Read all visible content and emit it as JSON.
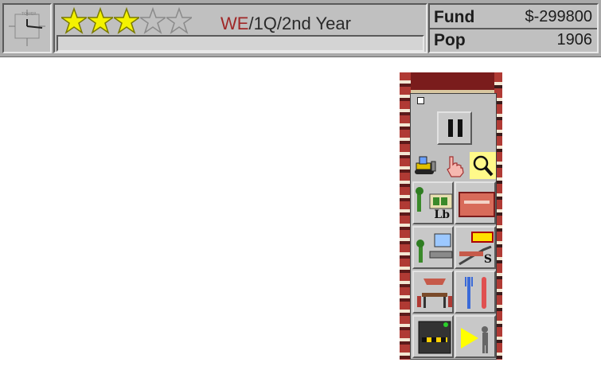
{
  "status_bar": {
    "rating": {
      "value": 3,
      "max": 5
    },
    "date": {
      "weekday": "WE",
      "rest": "/1Q/2nd Year"
    },
    "message": "",
    "fund": {
      "label": "Fund",
      "value": "$-299800"
    },
    "pop": {
      "label": "Pop",
      "value": "1906"
    }
  },
  "colors": {
    "star_filled": "#f4f200",
    "star_empty": "#c0c0c0",
    "weekday": "#a02828",
    "panel": "#c0c0c0",
    "tool_selected": "#fff98a"
  },
  "palette": {
    "tools": [
      {
        "icon": "bulldozer-icon",
        "selected": false
      },
      {
        "icon": "hand-pointer-icon",
        "selected": false
      },
      {
        "icon": "magnifier-icon",
        "selected": true
      }
    ],
    "facilities": [
      {
        "icon": "lobby-icon",
        "text": "Lb"
      },
      {
        "icon": "floor-icon",
        "text": ""
      },
      {
        "icon": "office-icon",
        "text": ""
      },
      {
        "icon": "stairs-escalator-icon",
        "text": "S"
      },
      {
        "icon": "restaurant-icon",
        "text": ""
      },
      {
        "icon": "fast-food-icon",
        "text": ""
      },
      {
        "icon": "elevator-icon",
        "text": ""
      },
      {
        "icon": "security-light-icon",
        "text": ""
      }
    ]
  }
}
